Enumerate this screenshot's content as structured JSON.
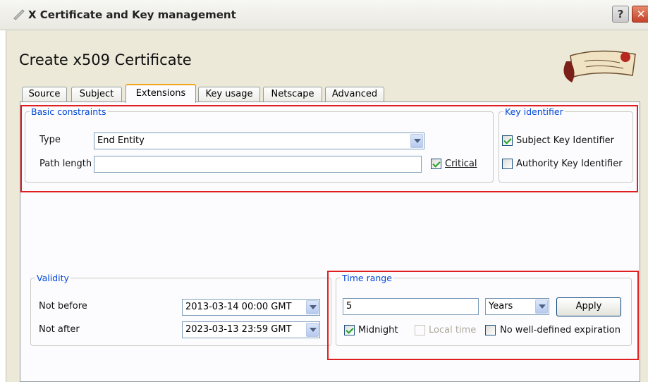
{
  "window": {
    "title": "X Certificate and Key management",
    "help_label": "?",
    "close_label": "✕"
  },
  "heading": "Create x509 Certificate",
  "tabs": [
    {
      "label": "Source"
    },
    {
      "label": "Subject"
    },
    {
      "label": "Extensions",
      "active": true
    },
    {
      "label": "Key usage"
    },
    {
      "label": "Netscape"
    },
    {
      "label": "Advanced"
    }
  ],
  "basic_constraints": {
    "legend": "Basic constraints",
    "type_label": "Type",
    "type_value": "End Entity",
    "path_length_label": "Path length",
    "path_length_value": "",
    "critical_label": "Critical",
    "critical_checked": true
  },
  "key_identifier": {
    "legend": "Key identifier",
    "subject_label": "Subject Key Identifier",
    "subject_checked": true,
    "authority_label": "Authority Key Identifier",
    "authority_checked": false
  },
  "validity": {
    "legend": "Validity",
    "not_before_label": "Not before",
    "not_before_value": "2013-03-14 00:00 GMT",
    "not_after_label": "Not after",
    "not_after_value": "2023-03-13 23:59 GMT"
  },
  "time_range": {
    "legend": "Time range",
    "amount_value": "5",
    "unit_value": "Years",
    "apply_label": "Apply",
    "midnight_label": "Midnight",
    "midnight_checked": true,
    "local_time_label": "Local time",
    "local_time_checked": false,
    "no_expiration_label": "No well-defined expiration",
    "no_expiration_checked": false
  },
  "colors": {
    "highlight_box": "#e02020",
    "group_legend": "#0046d5",
    "active_tab_accent": "#f4a418"
  }
}
